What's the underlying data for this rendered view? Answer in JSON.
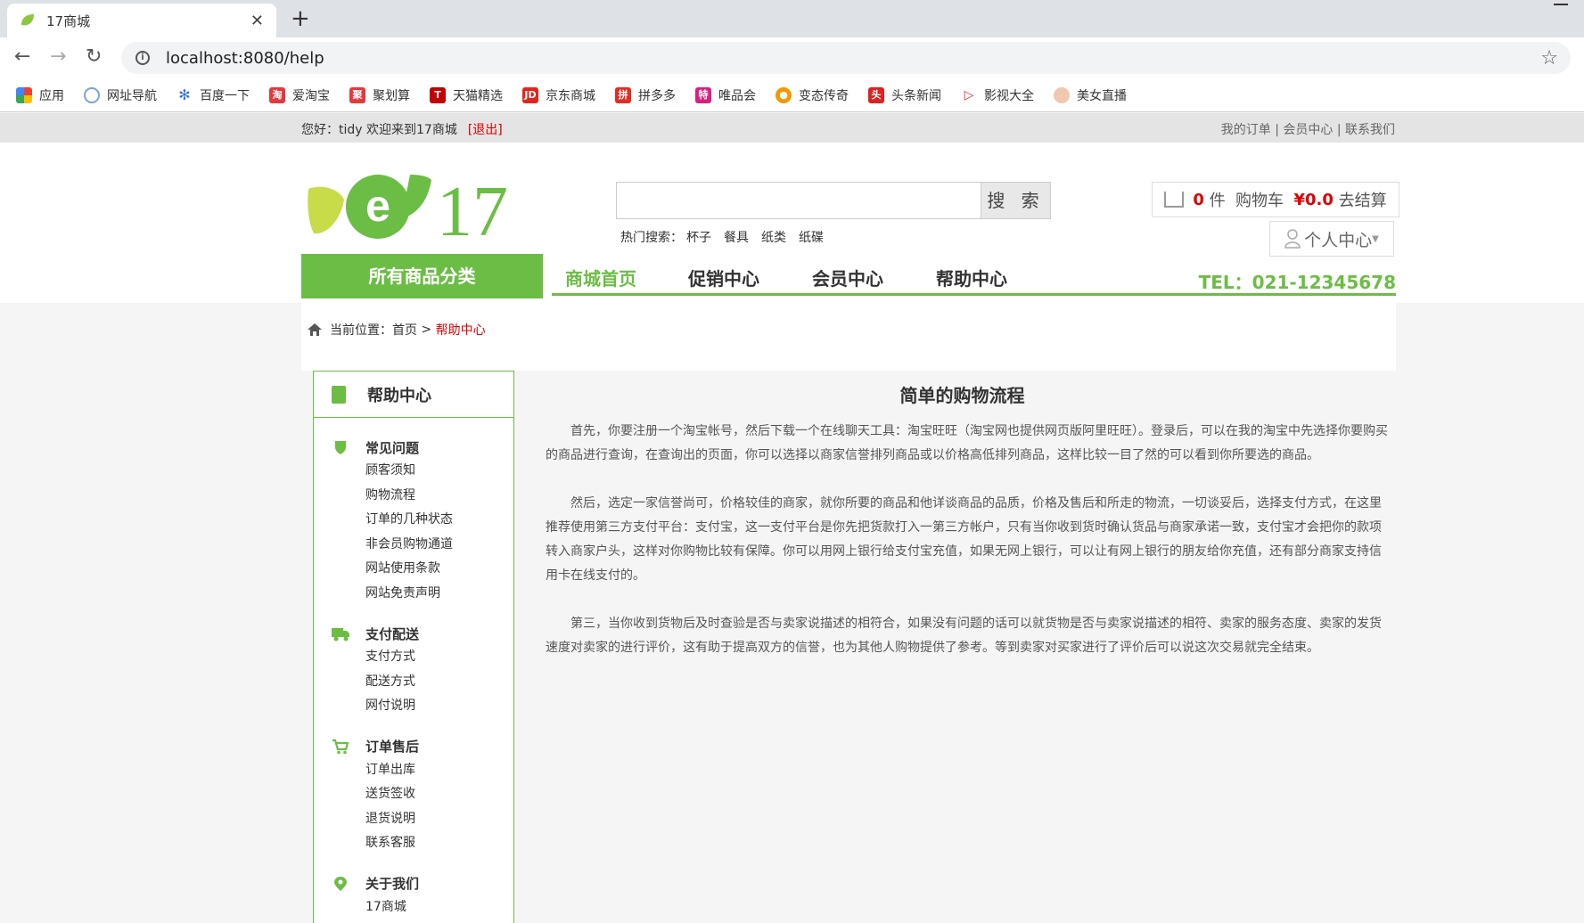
{
  "browser": {
    "tab_title": "17商城",
    "tab_close": "✕",
    "new_tab": "+",
    "url": "localhost:8080/help",
    "bookmarks": [
      "应用",
      "网址导航",
      "百度一下",
      "爱淘宝",
      "聚划算",
      "天猫精选",
      "京东商城",
      "拼多多",
      "唯品会",
      "变态传奇",
      "头条新闻",
      "影视大全",
      "美女直播"
    ]
  },
  "topbar": {
    "greeting": "您好：tidy 欢迎来到17商城",
    "logout": "[退出]",
    "links": "我的订单 | 会员中心 | 联系我们"
  },
  "header": {
    "logo_text": "17",
    "search_placeholder": "",
    "search_button": "搜 索",
    "hot_label": "热门搜索：",
    "hot_terms": [
      "杯子",
      "餐具",
      "纸类",
      "纸碟"
    ],
    "cart": {
      "count": "0",
      "unit": "件",
      "label": "购物车",
      "amount": "¥0.0",
      "checkout": "去结算"
    },
    "personal": "个人中心"
  },
  "nav": {
    "all_categories": "所有商品分类",
    "items": [
      "商城首页",
      "促销中心",
      "会员中心",
      "帮助中心"
    ],
    "tel": "TEL：021-12345678"
  },
  "breadcrumb": {
    "label": "当前位置：首页",
    "sep": ">",
    "current": "帮助中心"
  },
  "sidebar": {
    "title": "帮助中心",
    "groups": [
      {
        "title": "常见问题",
        "items": [
          "顾客须知",
          "购物流程",
          "订单的几种状态",
          "非会员购物通道",
          "网站使用条款",
          "网站免责声明"
        ]
      },
      {
        "title": "支付配送",
        "items": [
          "支付方式",
          "配送方式",
          "网付说明"
        ]
      },
      {
        "title": "订单售后",
        "items": [
          "订单出库",
          "送货签收",
          "退货说明",
          "联系客服"
        ]
      },
      {
        "title": "关于我们",
        "items": [
          "17商城"
        ]
      }
    ]
  },
  "content": {
    "title": "简单的购物流程",
    "paragraphs": [
      "首先，你要注册一个淘宝帐号，然后下载一个在线聊天工具：淘宝旺旺（淘宝网也提供网页版阿里旺旺）。登录后，可以在我的淘宝中先选择你要购买的商品进行查询，在查询出的页面，你可以选择以商家信誉排列商品或以价格高低排列商品，这样比较一目了然的可以看到你所要选的商品。",
      "然后，选定一家信誉尚可，价格较佳的商家，就你所要的商品和他详谈商品的品质，价格及售后和所走的物流，一切谈妥后，选择支付方式，在这里推荐使用第三方支付平台：支付宝，这一支付平台是你先把货款打入一第三方帐户，只有当你收到货时确认货品与商家承诺一致，支付宝才会把你的款项转入商家户头，这样对你购物比较有保障。你可以用网上银行给支付宝充值，如果无网上银行，可以让有网上银行的朋友给你充值，还有部分商家支持信用卡在线支付的。",
      "第三，当你收到货物后及时查验是否与卖家说描述的相符合，如果没有问题的话可以就货物是否与卖家说描述的相符、卖家的服务态度、卖家的发货速度对卖家的进行评价，这有助于提高双方的信誉，也为其他人购物提供了参考。等到卖家对买家进行了评价后可以说这次交易就完全结束。"
    ]
  }
}
